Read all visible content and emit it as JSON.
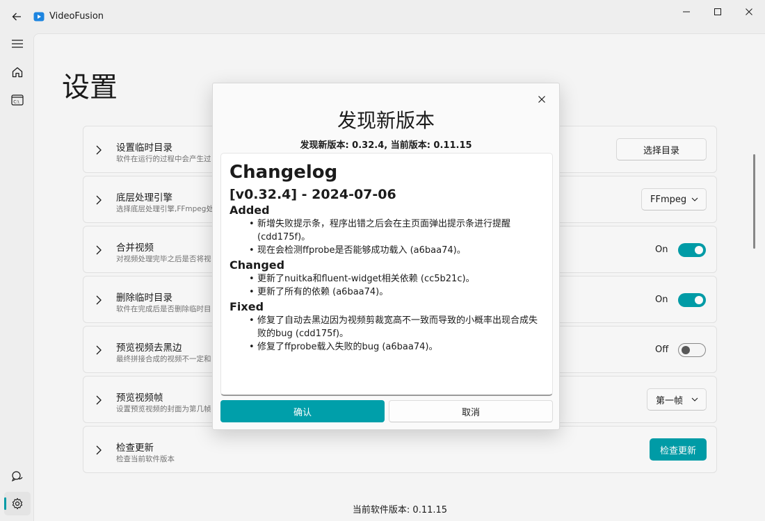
{
  "window": {
    "title": "VideoFusion",
    "accent_color": "#009faa"
  },
  "nav": {
    "items": [
      {
        "icon": "menu-icon"
      },
      {
        "icon": "home-icon"
      },
      {
        "icon": "terminal-icon"
      },
      {
        "icon": "feedback-icon"
      },
      {
        "icon": "settings-icon",
        "active": true
      }
    ]
  },
  "page": {
    "title": "设置",
    "footer_version": "当前软件版本: 0.11.15"
  },
  "settings": [
    {
      "title": "设置临时目录",
      "desc": "软件在运行的过程中会产生过",
      "control": "button",
      "control_label": "选择目录"
    },
    {
      "title": "底层处理引擎",
      "desc": "选择底层处理引擎,FFmpeg处",
      "control": "combo",
      "control_label": "FFmpeg"
    },
    {
      "title": "合并视频",
      "desc": "对视频处理完毕之后是否将视",
      "control": "toggle",
      "control_label": "On",
      "state": true
    },
    {
      "title": "删除临时目录",
      "desc": "软件在完成后是否删除临时目",
      "control": "toggle",
      "control_label": "On",
      "state": true
    },
    {
      "title": "预览视频去黑边",
      "desc": "最终拼接合成的视频不一定和",
      "control": "toggle",
      "control_label": "Off",
      "state": false
    },
    {
      "title": "预览视频帧",
      "desc": "设置预览视频的封面为第几帧",
      "control": "combo",
      "control_label": "第一帧"
    },
    {
      "title": "检查更新",
      "desc": "检查当前软件版本",
      "control": "accent-button",
      "control_label": "检查更新"
    }
  ],
  "dialog": {
    "title": "发现新版本",
    "subtitle": "发现新版本: 0.32.4, 当前版本: 0.11.15",
    "changelog": {
      "heading": "Changelog",
      "version_heading": "[v0.32.4] - 2024-07-06",
      "sections": [
        {
          "name": "Added",
          "items": [
            "新增失败提示条，程序出错之后会在主页面弹出提示条进行提醒 (cdd175f)。",
            "现在会检测ffprobe是否能够成功载入 (a6baa74)。"
          ]
        },
        {
          "name": "Changed",
          "items": [
            "更新了nuitka和fluent-widget相关依赖 (cc5b21c)。",
            "更新了所有的依赖 (a6baa74)。"
          ]
        },
        {
          "name": "Fixed",
          "items": [
            "修复了自动去黑边因为视频剪裁宽高不一致而导致的小概率出现合成失败的bug (cdd175f)。",
            "修复了ffprobe载入失败的bug (a6baa74)。"
          ]
        }
      ]
    },
    "ok_label": "确认",
    "cancel_label": "取消"
  }
}
